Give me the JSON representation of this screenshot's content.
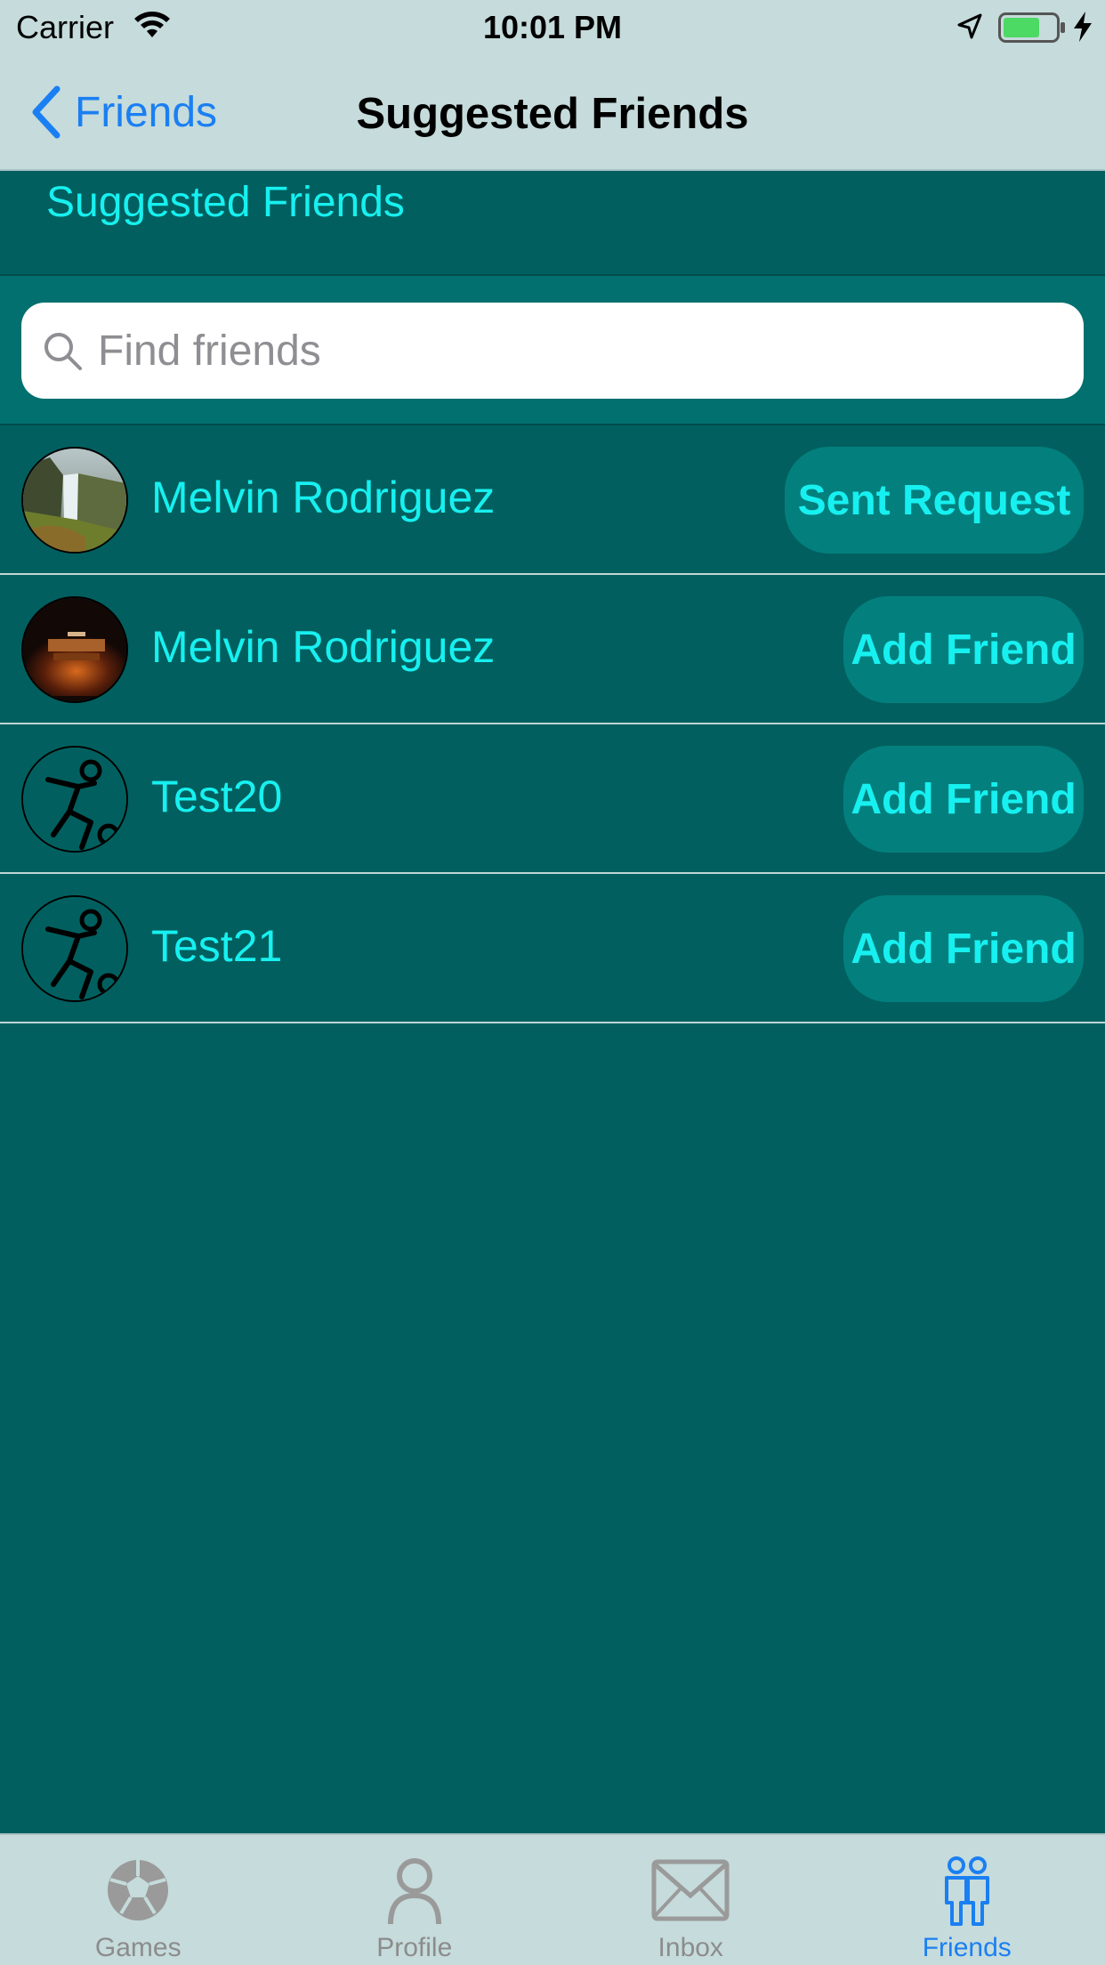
{
  "status_bar": {
    "carrier": "Carrier",
    "time": "10:01 PM",
    "battery_color": "#4cd964"
  },
  "nav": {
    "back_label": "Friends",
    "title": "Suggested Friends"
  },
  "section": {
    "title": "Suggested Friends"
  },
  "search": {
    "placeholder": "Find friends",
    "value": ""
  },
  "friends": [
    {
      "name": "Melvin Rodriguez",
      "action": "Sent Request",
      "avatar": "waterfall-photo"
    },
    {
      "name": "Melvin Rodriguez",
      "action": "Add Friend",
      "avatar": "avengers-poster"
    },
    {
      "name": "Test20",
      "action": "Add Friend",
      "avatar": "soccer-player-icon"
    },
    {
      "name": "Test21",
      "action": "Add Friend",
      "avatar": "soccer-player-icon"
    }
  ],
  "tabs": [
    {
      "label": "Games",
      "icon": "soccer-ball-icon",
      "active": false
    },
    {
      "label": "Profile",
      "icon": "person-icon",
      "active": false
    },
    {
      "label": "Inbox",
      "icon": "envelope-icon",
      "active": false
    },
    {
      "label": "Friends",
      "icon": "friends-icon",
      "active": true
    }
  ],
  "colors": {
    "accent_text": "#17f0f0",
    "background": "#01605f",
    "button_bg": "#03807e",
    "tint_blue": "#1a7ff2",
    "bar_bg": "#c6dbdb"
  }
}
